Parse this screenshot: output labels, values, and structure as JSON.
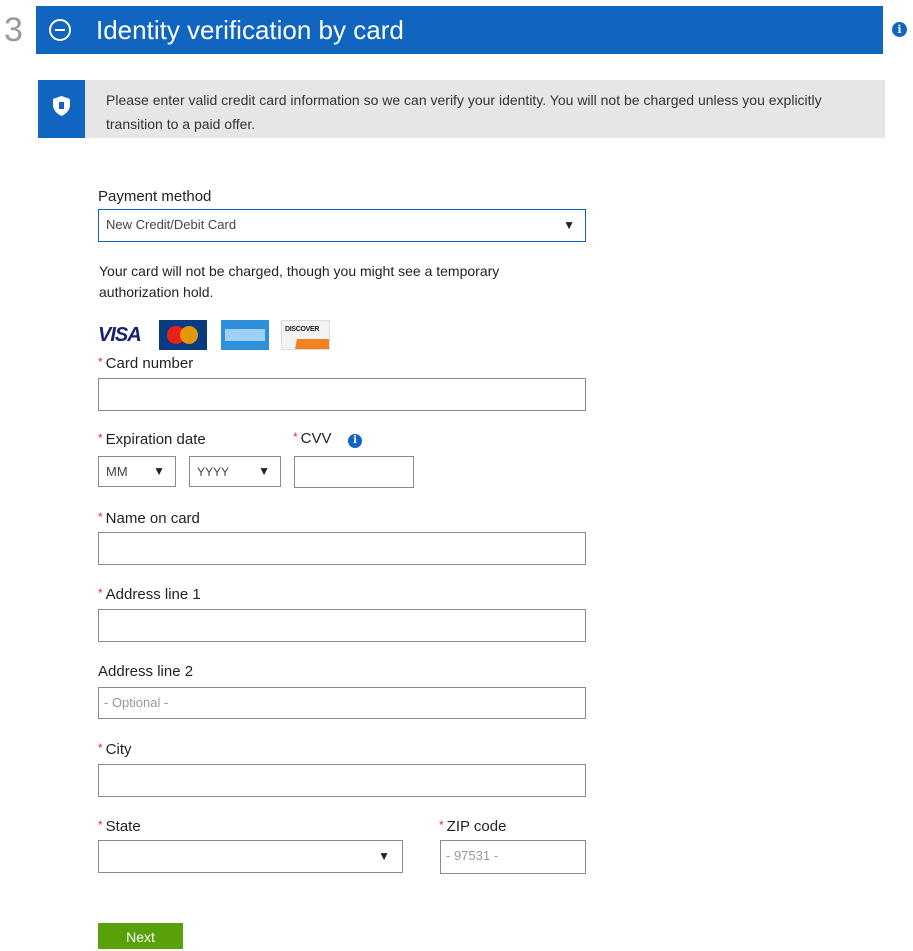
{
  "step": {
    "number": "3",
    "title": "Identity verification by card"
  },
  "notice": {
    "text": "Please enter valid credit card information so we can verify your identity. You will not be charged unless you explicitly transition to a paid offer."
  },
  "payment_method": {
    "label": "Payment method",
    "selected": "New Credit/Debit Card"
  },
  "charge_note": "Your card will not be charged, though you might see a temporary authorization hold.",
  "card_logos": [
    "VISA",
    "MasterCard",
    "American Express",
    "DISCOVER"
  ],
  "required_marker": "*",
  "form": {
    "card_number": {
      "label": "Card number"
    },
    "expiration": {
      "label": "Expiration date",
      "month": "MM",
      "year": "YYYY"
    },
    "cvv": {
      "label": "CVV"
    },
    "name_on_card": {
      "label": "Name on card"
    },
    "address1": {
      "label": "Address line 1"
    },
    "address2": {
      "label": "Address line 2",
      "placeholder": "- Optional -"
    },
    "city": {
      "label": "City"
    },
    "state": {
      "label": "State",
      "selected": ""
    },
    "zip": {
      "label": "ZIP code",
      "placeholder": "- 97531 -"
    }
  },
  "next_button": "Next",
  "colors": {
    "header_blue": "#0f65c0",
    "notice_gray": "#e6e6e6",
    "required_red": "#d13438",
    "next_green": "#59a10b"
  }
}
